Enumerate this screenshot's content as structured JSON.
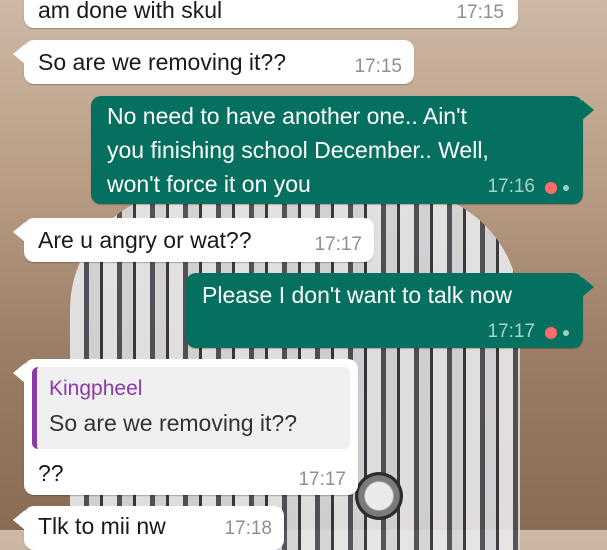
{
  "messages": [
    {
      "direction": "in",
      "text": "am done with skul",
      "time": "17:15"
    },
    {
      "direction": "in",
      "text": "So are we removing it??",
      "time": "17:15"
    },
    {
      "direction": "out",
      "lines": [
        "No need to have another one.. Ain't",
        "you finishing school December.. Well,",
        "won't force it on you"
      ],
      "time": "17:16"
    },
    {
      "direction": "in",
      "text": "Are u angry or wat??",
      "time": "17:17"
    },
    {
      "direction": "out",
      "text": "Please I don't want to talk now",
      "time": "17:17"
    },
    {
      "direction": "in",
      "quote": {
        "author": "Kingpheel",
        "text": "So are we removing it??"
      },
      "text": "??",
      "time": "17:17"
    },
    {
      "direction": "in",
      "text": "Tlk to mii nw",
      "time": "17:18"
    }
  ],
  "colors": {
    "outgoing_bubble": "#05705f",
    "incoming_bubble": "#ffffff",
    "quote_author": "#8b3aa9",
    "status_dot": "#ff6b6b"
  }
}
